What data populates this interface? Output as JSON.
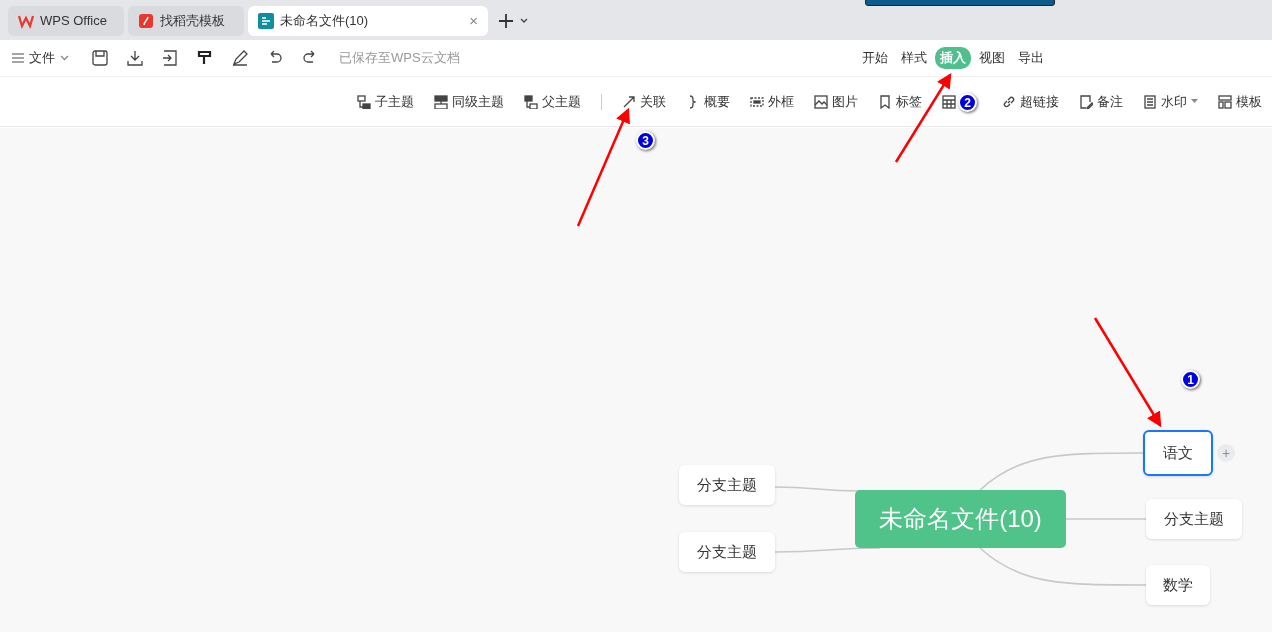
{
  "tabs": [
    {
      "label": "WPS Office",
      "selected": false,
      "kind": "wps"
    },
    {
      "label": "找稻壳模板",
      "selected": false,
      "kind": "docer"
    },
    {
      "label": "未命名文件(10)",
      "selected": true,
      "kind": "mind",
      "close_glyph": "×"
    }
  ],
  "toolbar": {
    "file_menu": "文件",
    "save_status": "已保存至WPS云文档"
  },
  "ribbon_tabs": [
    {
      "label": "开始",
      "selected": false
    },
    {
      "label": "样式",
      "selected": false
    },
    {
      "label": "插入",
      "selected": true
    },
    {
      "label": "视图",
      "selected": false
    },
    {
      "label": "导出",
      "selected": false
    }
  ],
  "insert_tools": [
    {
      "label": "子主题",
      "kind": "child"
    },
    {
      "label": "同级主题",
      "kind": "sibling"
    },
    {
      "label": "父主题",
      "kind": "parent"
    },
    {
      "label": "关联",
      "kind": "relation"
    },
    {
      "label": "概要",
      "kind": "summary"
    },
    {
      "label": "外框",
      "kind": "frame"
    },
    {
      "label": "图片",
      "kind": "image"
    },
    {
      "label": "标签",
      "kind": "tag"
    },
    {
      "kind": "table"
    },
    {
      "label": "超链接",
      "kind": "link"
    },
    {
      "label": "备注",
      "kind": "note"
    },
    {
      "label": "水印",
      "kind": "watermark"
    },
    {
      "label": "模板",
      "kind": "template"
    }
  ],
  "mindmap": {
    "root": "未命名文件(10)",
    "nodes": [
      {
        "label": "语文",
        "selected": true,
        "add_glyph": "+"
      },
      {
        "label": "分支主题",
        "selected": false
      },
      {
        "label": "数学",
        "selected": false
      },
      {
        "label": "分支主题",
        "selected": false
      },
      {
        "label": "分支主题",
        "selected": false
      }
    ]
  },
  "annotations": [
    {
      "label": "1"
    },
    {
      "label": "2"
    },
    {
      "label": "3"
    }
  ]
}
